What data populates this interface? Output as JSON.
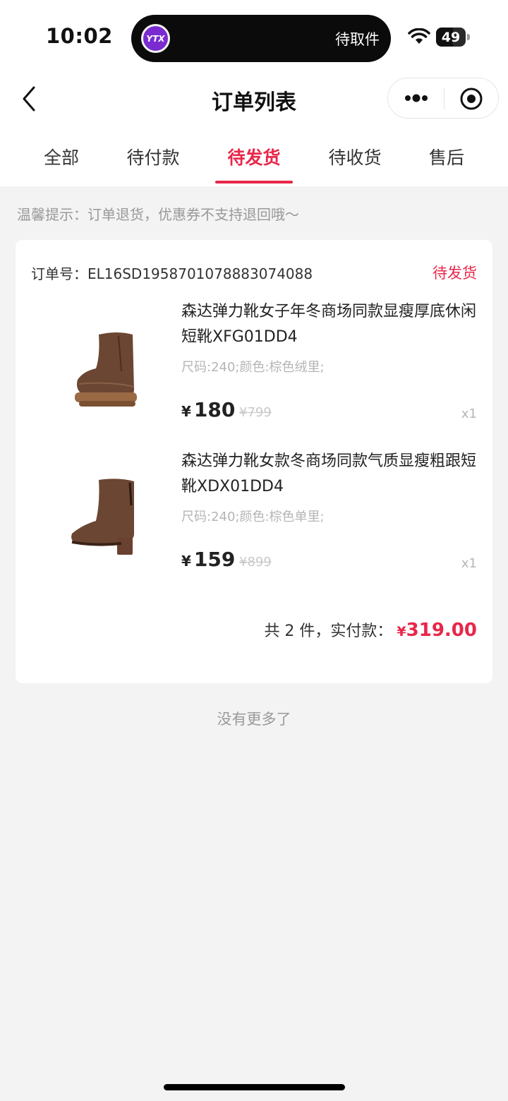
{
  "status_bar": {
    "time": "10:02",
    "island_text": "待取件",
    "island_logo_text": "YTX",
    "battery": "49"
  },
  "header": {
    "title": "订单列表"
  },
  "tabs": [
    {
      "label": "全部",
      "active": false
    },
    {
      "label": "待付款",
      "active": false
    },
    {
      "label": "待发货",
      "active": true
    },
    {
      "label": "待收货",
      "active": false
    },
    {
      "label": "售后",
      "active": false
    }
  ],
  "tip": "温馨提示：订单退货，优惠券不支持退回哦～",
  "order": {
    "number_label": "订单号：",
    "number": "EL16SD1958701078883074088",
    "status": "待发货",
    "items": [
      {
        "name": "森达弹力靴女子年冬商场同款显瘦厚底休闲短靴XFG01DD4",
        "spec": "尺码:240;颜色:棕色绒里;",
        "currency": "¥",
        "price": "180",
        "original_price": "¥799",
        "quantity": "x1"
      },
      {
        "name": "森达弹力靴女款冬商场同款气质显瘦粗跟短靴XDX01DD4",
        "spec": "尺码:240;颜色:棕色单里;",
        "currency": "¥",
        "price": "159",
        "original_price": "¥899",
        "quantity": "x1"
      }
    ],
    "summary_prefix": "共 2 件，实付款：",
    "summary_currency": "¥",
    "summary_amount": "319.00"
  },
  "footer_text": "没有更多了",
  "colors": {
    "accent": "#e8274a",
    "background": "#f3f3f3",
    "boot_brown": "#6b4632"
  }
}
